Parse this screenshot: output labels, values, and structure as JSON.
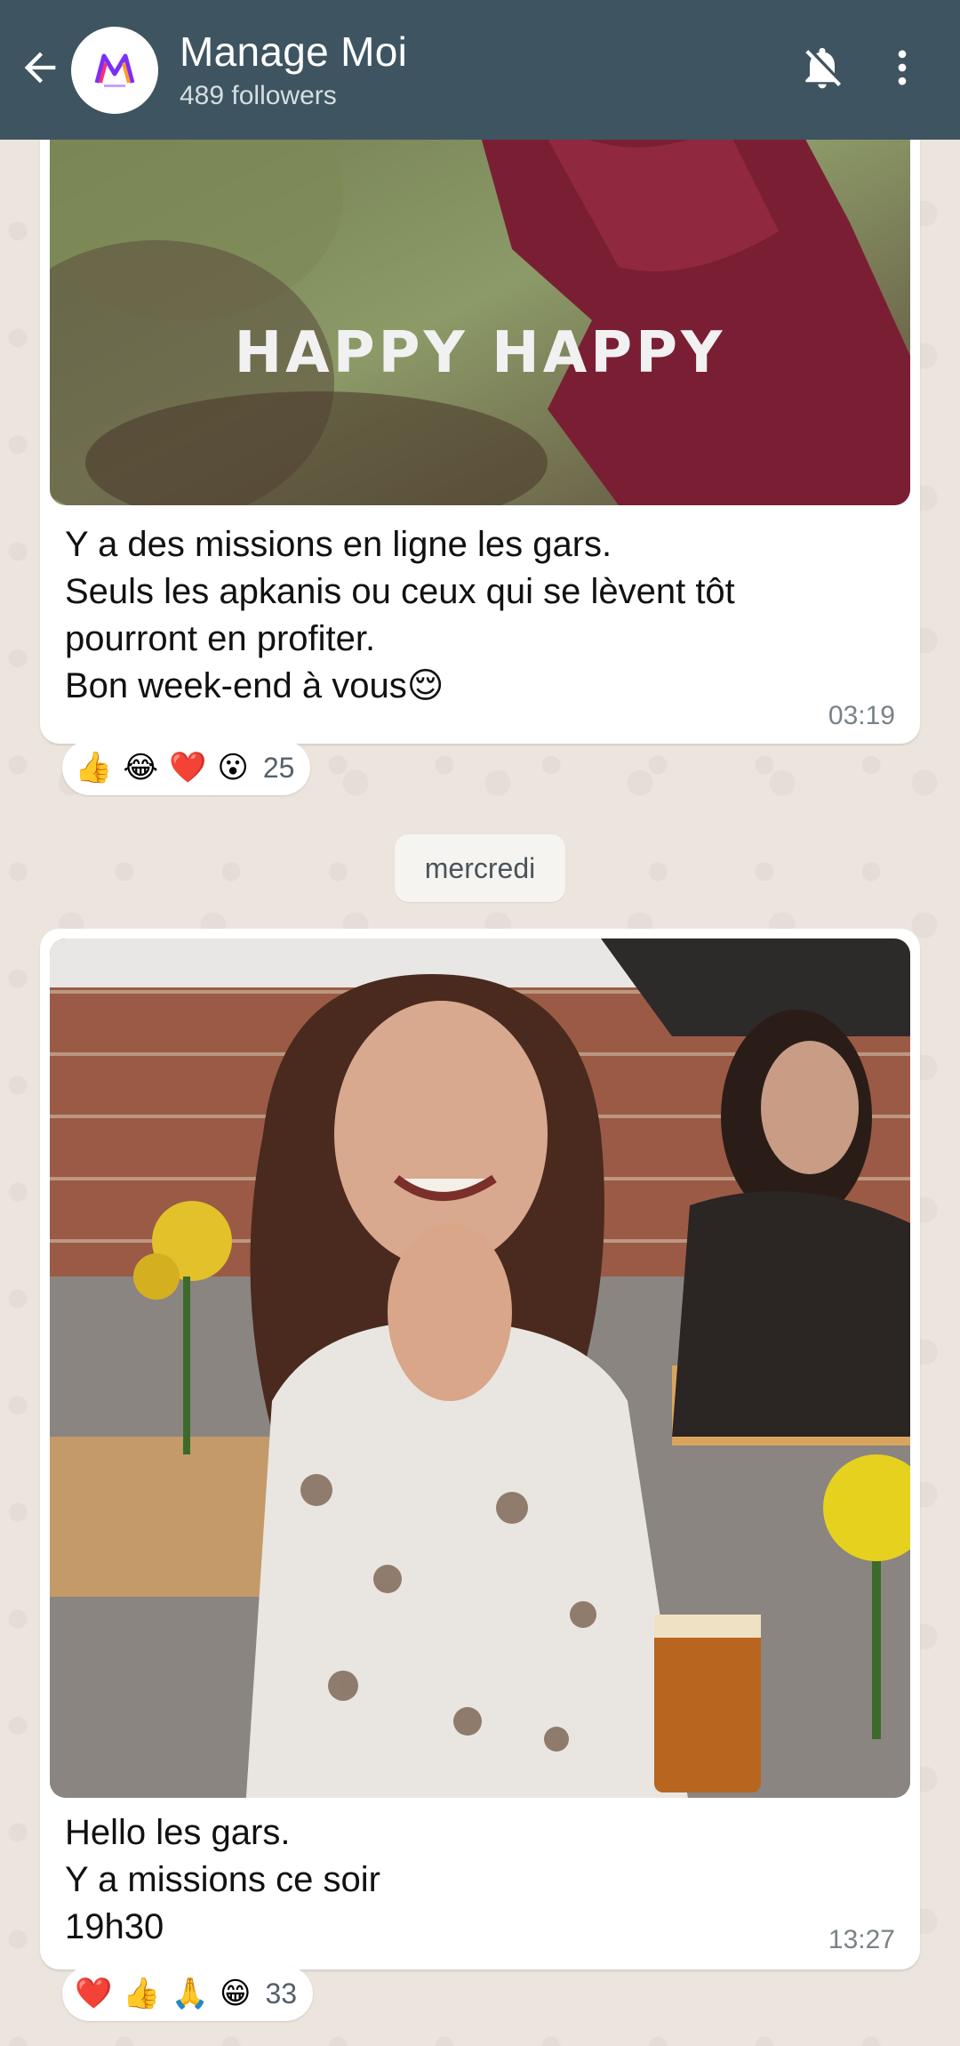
{
  "header": {
    "title": "Manage Moi",
    "subtitle": "489 followers",
    "back_icon": "arrow-left-icon",
    "mute_icon": "bell-off-icon",
    "menu_icon": "more-vertical-icon",
    "bg_color": "#3e5461"
  },
  "messages": [
    {
      "media_caption": "HAPPY HAPPY",
      "text": "Y a des missions en ligne les gars.\nSeuls les apkanis ou ceux qui se lèvent tôt pourront en profiter.\nBon week-end à vous😌",
      "time": "03:19",
      "reactions": [
        "👍",
        "😂",
        "❤️",
        "😮"
      ],
      "reaction_count": "25"
    },
    {
      "text": "Hello les gars.\nY a missions ce soir\n19h30",
      "time": "13:27",
      "reactions": [
        "❤️",
        "👍",
        "🙏",
        "😁"
      ],
      "reaction_count": "33"
    }
  ],
  "date_separator": "mercredi"
}
